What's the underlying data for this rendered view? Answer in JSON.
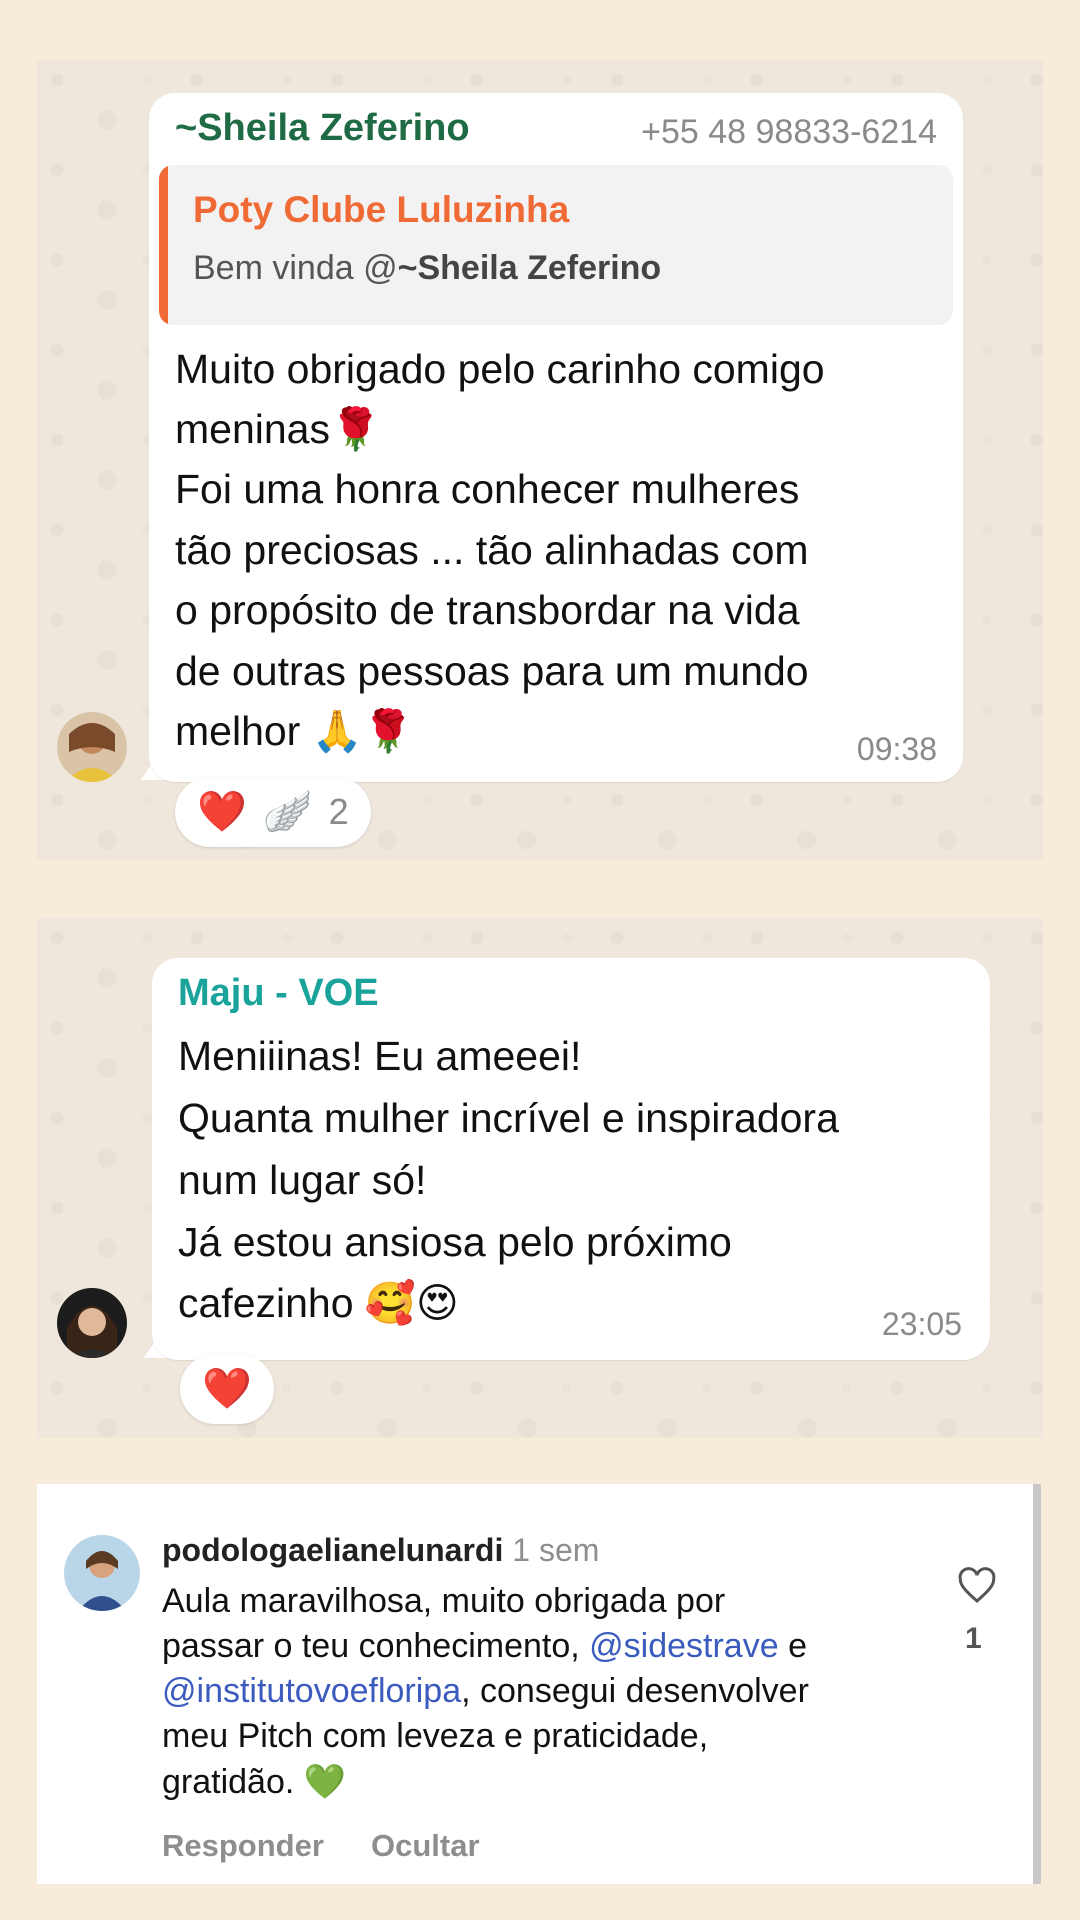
{
  "chat1": {
    "sender": "~Sheila Zeferino",
    "phone": "+55 48 98833-6214",
    "quote": {
      "title": "Poty Clube Luluzinha",
      "text_prefix": "Bem vinda @",
      "text_mention": "~Sheila Zeferino"
    },
    "message_lines": [
      "Muito obrigado pelo carinho comigo",
      "meninas🌹",
      "Foi uma honra conhecer mulheres",
      "tão preciosas ... tão alinhadas com",
      "o propósito de transbordar na vida",
      "de outras pessoas para um mundo",
      "melhor 🙏🌹"
    ],
    "time": "09:38",
    "reactions": [
      "❤️",
      "🪽"
    ],
    "reaction_count": "2",
    "sender_color": "#1f6b45"
  },
  "chat2": {
    "sender": "Maju - VOE",
    "message_lines": [
      "Meniiinas! Eu ameeei!",
      "Quanta mulher incrível e inspiradora",
      "num lugar só!",
      "Já estou ansiosa pelo próximo",
      "cafezinho 🥰😍"
    ],
    "time": "23:05",
    "reactions": [
      "❤️"
    ],
    "sender_color": "#1aa39a"
  },
  "comment": {
    "username": "podologaelianelunardi",
    "age": "1 sem",
    "line1": "Aula maravilhosa, muito obrigada por",
    "line2_prefix": "passar o teu conhecimento, ",
    "line2_mention": "@sidestrave",
    "line2_suffix": " e",
    "line3_mention": "@institutovoefloripa",
    "line3_suffix": ", consegui desenvolver",
    "line4": "meu Pitch com leveza e praticidade,",
    "line5": "gratidão. 💚",
    "reply_label": "Responder",
    "hide_label": "Ocultar",
    "like_count": "1"
  }
}
